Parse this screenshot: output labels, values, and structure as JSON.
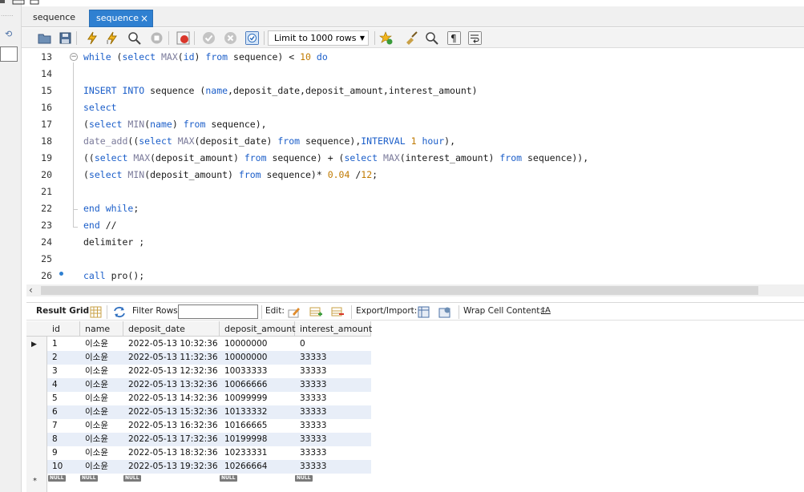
{
  "tabs": [
    {
      "label": "sequence"
    },
    {
      "label": "sequence",
      "close": "×"
    }
  ],
  "toolbar": {
    "limit_select_value": "Limit to 1000 rows"
  },
  "editor": {
    "lines": [
      {
        "num": "13",
        "segments": [
          [
            "kw",
            "while"
          ],
          [
            "plain",
            " ("
          ],
          [
            "kw",
            "select"
          ],
          [
            "plain",
            " "
          ],
          [
            "fn",
            "MAX"
          ],
          [
            "plain",
            "("
          ],
          [
            "kw",
            "id"
          ],
          [
            "plain",
            ") "
          ],
          [
            "kw",
            "from"
          ],
          [
            "plain",
            " sequence) < "
          ],
          [
            "num",
            "10"
          ],
          [
            "plain",
            " "
          ],
          [
            "kw",
            "do"
          ]
        ]
      },
      {
        "num": "14",
        "segments": []
      },
      {
        "num": "15",
        "segments": [
          [
            "kw",
            "INSERT INTO"
          ],
          [
            "plain",
            " sequence ("
          ],
          [
            "kw",
            "name"
          ],
          [
            "plain",
            ",deposit_date,deposit_amount,interest_amount)"
          ]
        ]
      },
      {
        "num": "16",
        "segments": [
          [
            "kw",
            "select"
          ]
        ]
      },
      {
        "num": "17",
        "segments": [
          [
            "plain",
            "("
          ],
          [
            "kw",
            "select"
          ],
          [
            "plain",
            " "
          ],
          [
            "fn",
            "MIN"
          ],
          [
            "plain",
            "("
          ],
          [
            "kw",
            "name"
          ],
          [
            "plain",
            ") "
          ],
          [
            "kw",
            "from"
          ],
          [
            "plain",
            " sequence),"
          ]
        ]
      },
      {
        "num": "18",
        "segments": [
          [
            "fn",
            "date_add"
          ],
          [
            "plain",
            "(("
          ],
          [
            "kw",
            "select"
          ],
          [
            "plain",
            " "
          ],
          [
            "fn",
            "MAX"
          ],
          [
            "plain",
            "(deposit_date) "
          ],
          [
            "kw",
            "from"
          ],
          [
            "plain",
            " sequence),"
          ],
          [
            "kw",
            "INTERVAL"
          ],
          [
            "plain",
            " "
          ],
          [
            "num",
            "1"
          ],
          [
            "plain",
            " "
          ],
          [
            "kw",
            "hour"
          ],
          [
            "plain",
            "),"
          ]
        ]
      },
      {
        "num": "19",
        "segments": [
          [
            "plain",
            "(("
          ],
          [
            "kw",
            "select"
          ],
          [
            "plain",
            " "
          ],
          [
            "fn",
            "MAX"
          ],
          [
            "plain",
            "(deposit_amount) "
          ],
          [
            "kw",
            "from"
          ],
          [
            "plain",
            " sequence) + ("
          ],
          [
            "kw",
            "select"
          ],
          [
            "plain",
            " "
          ],
          [
            "fn",
            "MAX"
          ],
          [
            "plain",
            "(interest_amount) "
          ],
          [
            "kw",
            "from"
          ],
          [
            "plain",
            " sequence)),"
          ]
        ]
      },
      {
        "num": "20",
        "segments": [
          [
            "plain",
            "("
          ],
          [
            "kw",
            "select"
          ],
          [
            "plain",
            " "
          ],
          [
            "fn",
            "MIN"
          ],
          [
            "plain",
            "(deposit_amount) "
          ],
          [
            "kw",
            "from"
          ],
          [
            "plain",
            " sequence)* "
          ],
          [
            "num",
            "0.04"
          ],
          [
            "plain",
            " /"
          ],
          [
            "num",
            "12"
          ],
          [
            "plain",
            ";"
          ]
        ]
      },
      {
        "num": "21",
        "segments": []
      },
      {
        "num": "22",
        "segments": [
          [
            "kw",
            "end while"
          ],
          [
            "plain",
            ";"
          ]
        ]
      },
      {
        "num": "23",
        "segments": [
          [
            "kw",
            "end"
          ],
          [
            "plain",
            " //"
          ]
        ]
      },
      {
        "num": "24",
        "segments": [
          [
            "plain",
            "delimiter ;"
          ]
        ]
      },
      {
        "num": "25",
        "segments": []
      },
      {
        "num": "26",
        "segments": [
          [
            "kw",
            "call"
          ],
          [
            "plain",
            " pro();"
          ]
        ]
      }
    ]
  },
  "result_toolbar": {
    "result_grid": "Result Grid",
    "filter_rows": "Filter Rows:",
    "edit": "Edit:",
    "export_import": "Export/Import:",
    "wrap_cell": "Wrap Cell Content:",
    "wrap_icon_glyph": "‡A"
  },
  "grid": {
    "columns": [
      "id",
      "name",
      "deposit_date",
      "deposit_amount",
      "interest_amount"
    ],
    "rows": [
      [
        "1",
        "이소윤",
        "2022-05-13 10:32:36",
        "10000000",
        "0"
      ],
      [
        "2",
        "이소윤",
        "2022-05-13 11:32:36",
        "10000000",
        "33333"
      ],
      [
        "3",
        "이소윤",
        "2022-05-13 12:32:36",
        "10033333",
        "33333"
      ],
      [
        "4",
        "이소윤",
        "2022-05-13 13:32:36",
        "10066666",
        "33333"
      ],
      [
        "5",
        "이소윤",
        "2022-05-13 14:32:36",
        "10099999",
        "33333"
      ],
      [
        "6",
        "이소윤",
        "2022-05-13 15:32:36",
        "10133332",
        "33333"
      ],
      [
        "7",
        "이소윤",
        "2022-05-13 16:32:36",
        "10166665",
        "33333"
      ],
      [
        "8",
        "이소윤",
        "2022-05-13 17:32:36",
        "10199998",
        "33333"
      ],
      [
        "9",
        "이소윤",
        "2022-05-13 18:32:36",
        "10233331",
        "33333"
      ],
      [
        "10",
        "이소윤",
        "2022-05-13 19:32:36",
        "10266664",
        "33333"
      ]
    ],
    "null_label": "NULL",
    "new_row_marker": "*",
    "current_row_marker": "▶"
  }
}
